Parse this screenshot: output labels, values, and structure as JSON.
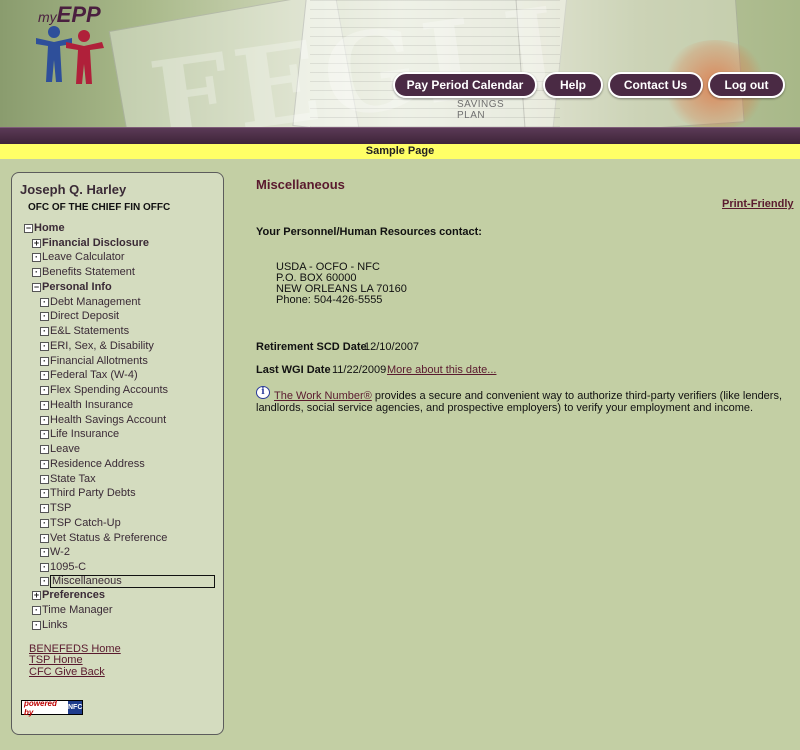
{
  "header": {
    "logo_small": "my",
    "logo_large": "EPP",
    "background_text": "FEGLI",
    "savings_line1": "SAVINGS",
    "savings_line2": "PLAN",
    "nav": {
      "pay_period_calendar": "Pay Period Calendar",
      "help": "Help",
      "contact_us": "Contact Us",
      "log_out": "Log out"
    },
    "sample_banner": "Sample Page"
  },
  "sidebar": {
    "user_name": "Joseph Q. Harley",
    "user_org": "OFC OF THE CHIEF FIN OFFC",
    "tree": {
      "home": "Home",
      "financial_disclosure": "Financial Disclosure",
      "leave_calculator": "Leave Calculator",
      "benefits_statement": "Benefits Statement",
      "personal_info": "Personal Info",
      "personal_items": [
        "Debt Management",
        "Direct Deposit",
        "E&L Statements",
        "ERI, Sex, & Disability",
        "Financial Allotments",
        "Federal Tax (W-4)",
        "Flex Spending Accounts",
        "Health Insurance",
        "Health Savings Account",
        "Life Insurance",
        "Leave",
        "Residence Address",
        "State Tax",
        "Third Party Debts",
        "TSP",
        "TSP Catch-Up",
        "Vet Status & Preference",
        "W-2",
        "1095-C",
        "Miscellaneous"
      ],
      "preferences": "Preferences",
      "time_manager": "Time Manager",
      "links": "Links"
    },
    "links": {
      "benefeds_home": "BENEFEDS Home",
      "tsp_home": "TSP Home",
      "cfc_give_back": "CFC Give Back"
    },
    "powered_by": "powered by",
    "powered_logo": "NFC"
  },
  "main": {
    "title": "Miscellaneous",
    "print_friendly": "Print-Friendly",
    "hr_contact_label": "Your Personnel/Human Resources contact:",
    "address": {
      "line1": "USDA - OCFO - NFC",
      "line2": "P.O. BOX 60000",
      "line3": "NEW ORLEANS  LA 70160",
      "phone": "Phone: 504-426-5555"
    },
    "retirement_scd_label": "Retirement SCD Date",
    "retirement_scd_value": "12/10/2007",
    "last_wgi_label": "Last WGI Date",
    "last_wgi_value": "11/22/2009",
    "more_about_link": "More about this date...",
    "work_number_link": "The Work Number®",
    "work_number_text": " provides a secure and convenient way to authorize third-party verifiers (like lenders, landlords, social service agencies, and prospective employers) to verify your employment and income."
  }
}
